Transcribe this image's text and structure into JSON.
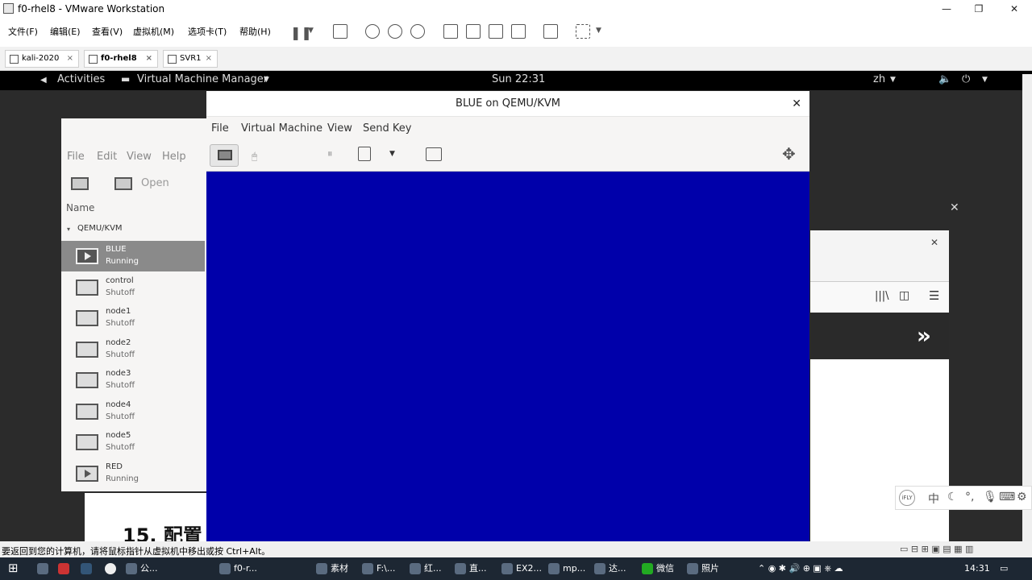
{
  "vmware": {
    "title": "f0-rhel8 - VMware Workstation",
    "menu": [
      "文件(F)",
      "编辑(E)",
      "查看(V)",
      "虚拟机(M)",
      "选项卡(T)",
      "帮助(H)"
    ],
    "tabs": [
      {
        "label": "kali-2020"
      },
      {
        "label": "f0-rhel8"
      },
      {
        "label": "SVR1"
      }
    ],
    "status_message": "要返回到您的计算机，请将鼠标指针从虚拟机中移出或按 Ctrl+Alt。"
  },
  "gnome": {
    "activities": "Activities",
    "app_menu": "Virtual Machine Manager",
    "clock": "Sun 22:31",
    "input_method": "zh"
  },
  "virt_manager": {
    "menu": [
      "File",
      "Edit",
      "View",
      "Help"
    ],
    "open_label": "Open",
    "column_header": "Name",
    "connection": "QEMU/KVM",
    "vms": [
      {
        "name": "BLUE",
        "status": "Running",
        "selected": true
      },
      {
        "name": "control",
        "status": "Shutoff"
      },
      {
        "name": "node1",
        "status": "Shutoff"
      },
      {
        "name": "node2",
        "status": "Shutoff"
      },
      {
        "name": "node3",
        "status": "Shutoff"
      },
      {
        "name": "node4",
        "status": "Shutoff"
      },
      {
        "name": "node5",
        "status": "Shutoff"
      },
      {
        "name": "RED",
        "status": "Running"
      }
    ]
  },
  "console": {
    "title": "BLUE on QEMU/KVM",
    "menu": [
      "File",
      "Virtual Machine",
      "View",
      "Send Key"
    ],
    "screen_color": "#0000aa"
  },
  "document": {
    "heading": "15. 配置"
  },
  "taskbar": {
    "items": [
      "公...",
      "f0-r...",
      "素材",
      "F:\\...",
      "红...",
      "直...",
      "EX2...",
      "mp...",
      "达...",
      "微信",
      "照片"
    ],
    "clock": "14:31"
  }
}
